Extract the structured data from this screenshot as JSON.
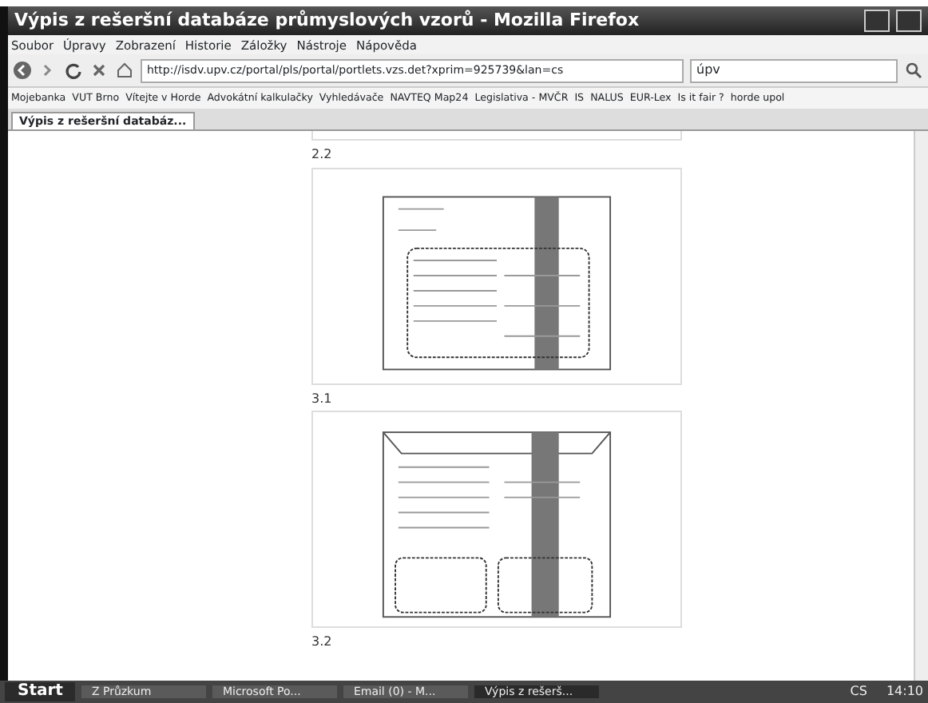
{
  "window": {
    "title": "Výpis z rešeršní databáze průmyslových vzorů - Mozilla Firefox"
  },
  "menu": [
    "Soubor",
    "Úpravy",
    "Zobrazení",
    "Historie",
    "Záložky",
    "Nástroje",
    "Nápověda"
  ],
  "address_bar": {
    "value": "http://isdv.upv.cz/portal/pls/portal/portlets.vzs.det?xprim=925739&lan=cs"
  },
  "search": {
    "value": "úpv"
  },
  "bookmarks": [
    "Mojebanka",
    "VUT Brno",
    "Vítejte v Horde",
    "Advokátní kalkulačky",
    "Vyhledávače",
    "NAVTEQ Map24",
    "Legislativa - MVČR",
    "IS",
    "NALUS",
    "EUR-Lex",
    "Is it fair ?",
    "horde upol"
  ],
  "tabs": [
    {
      "label": "Výpis z rešeršní databáz...",
      "selected": true
    }
  ],
  "content": {
    "sections": [
      {
        "label": "2.2",
        "kind": "form"
      },
      {
        "label": "3.1",
        "kind": "envelope"
      },
      {
        "label": "3.2",
        "kind": "none"
      }
    ]
  },
  "taskbar": {
    "start": "Start",
    "items": [
      {
        "label": "Z Průzkum",
        "selected": false
      },
      {
        "label": "Microsoft Po...",
        "selected": false
      },
      {
        "label": "Email (0) - M...",
        "selected": false
      },
      {
        "label": "Výpis z rešerš...",
        "selected": true
      }
    ],
    "language": "CS",
    "clock": "14:10"
  }
}
